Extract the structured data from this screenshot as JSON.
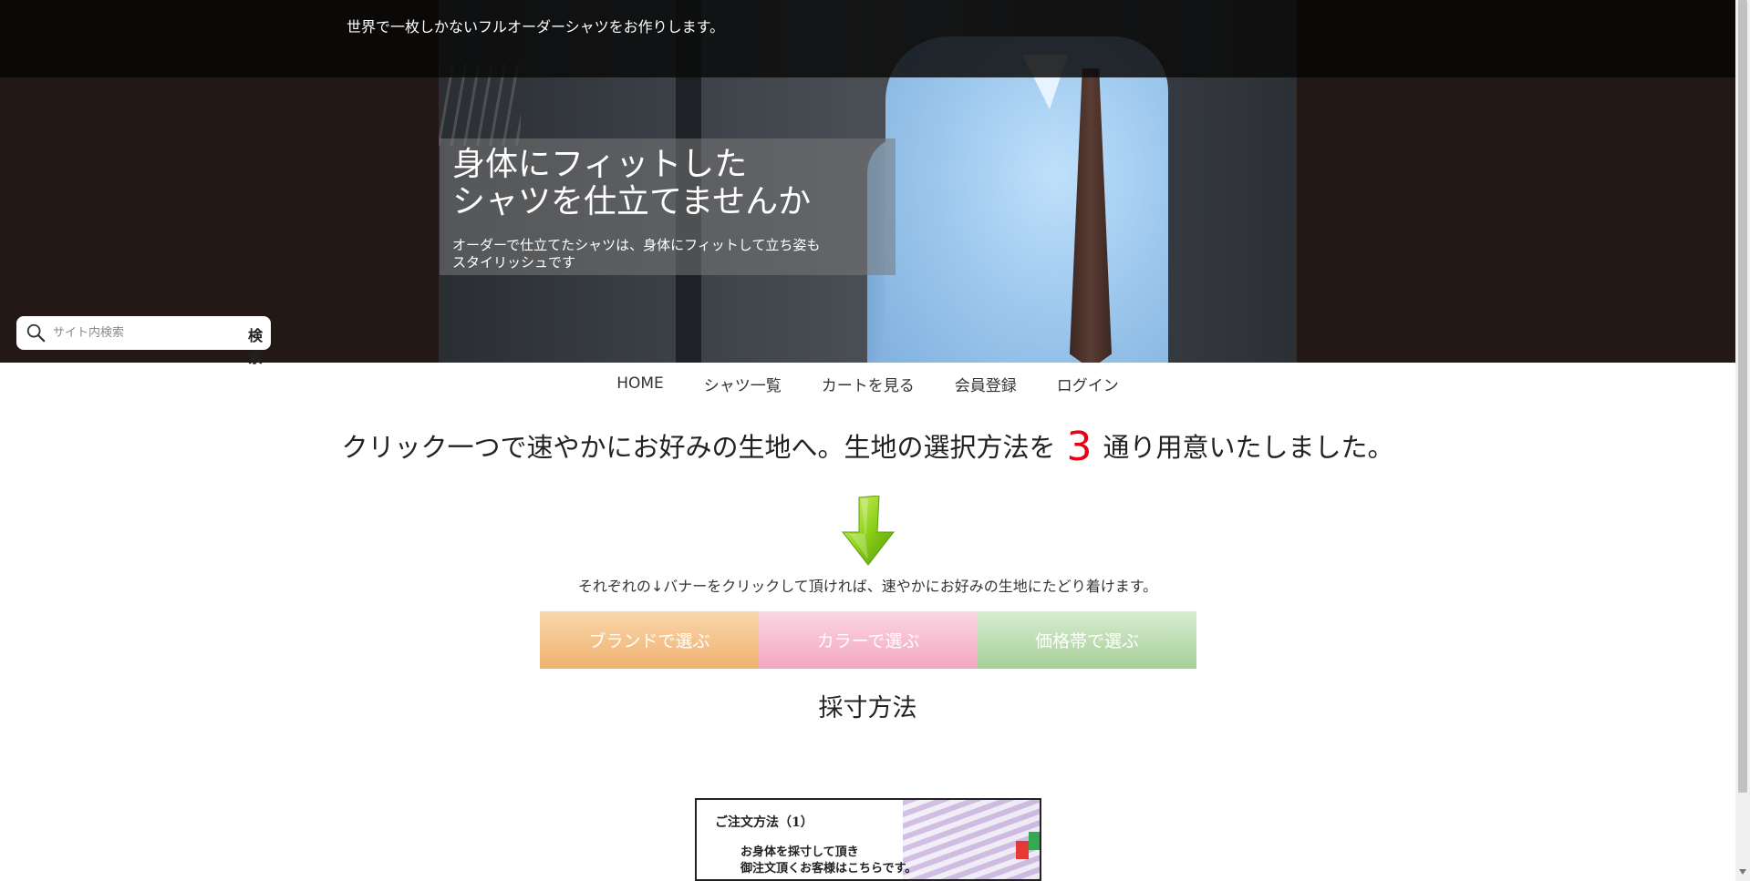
{
  "header": {
    "tagline": "世界で一枚しかないフルオーダーシャツをお作りします。",
    "hero_title_line1": "身体にフィットした",
    "hero_title_line2": "シャツを仕立てませんか",
    "hero_sub_line1": "オーダーで仕立てたシャツは、身体にフィットして立ち姿も",
    "hero_sub_line2": "スタイリッシュです"
  },
  "search": {
    "placeholder": "サイト内検索",
    "button_label": "検索",
    "icon": "search-icon"
  },
  "nav": {
    "items": [
      "HOME",
      "シャツ一覧",
      "カートを見る",
      "会員登録",
      "ログイン"
    ]
  },
  "main": {
    "headline_before": "クリック一つで速やかにお好みの生地へ。生地の選択方法を",
    "headline_number": "3",
    "headline_after": "通り用意いたしました。",
    "arrow_icon": "down-arrow-icon",
    "note": "それぞれの↓バナーをクリックして頂ければ、速やかにお好みの生地にたどり着けます。",
    "banners": [
      "ブランドで選ぶ",
      "カラーで選ぶ",
      "価格帯で選ぶ"
    ],
    "section_title": "採寸方法"
  },
  "order_card": {
    "title": "ご注文方法（1）",
    "line1": "お身体を採寸して頂き",
    "line2": "御注文頂くお客様はこちらです。"
  },
  "colors": {
    "accent_red": "#e60012",
    "brand_banner": "#f0b26d",
    "color_banner": "#f3a6c0",
    "price_banner": "#a6cf98"
  }
}
